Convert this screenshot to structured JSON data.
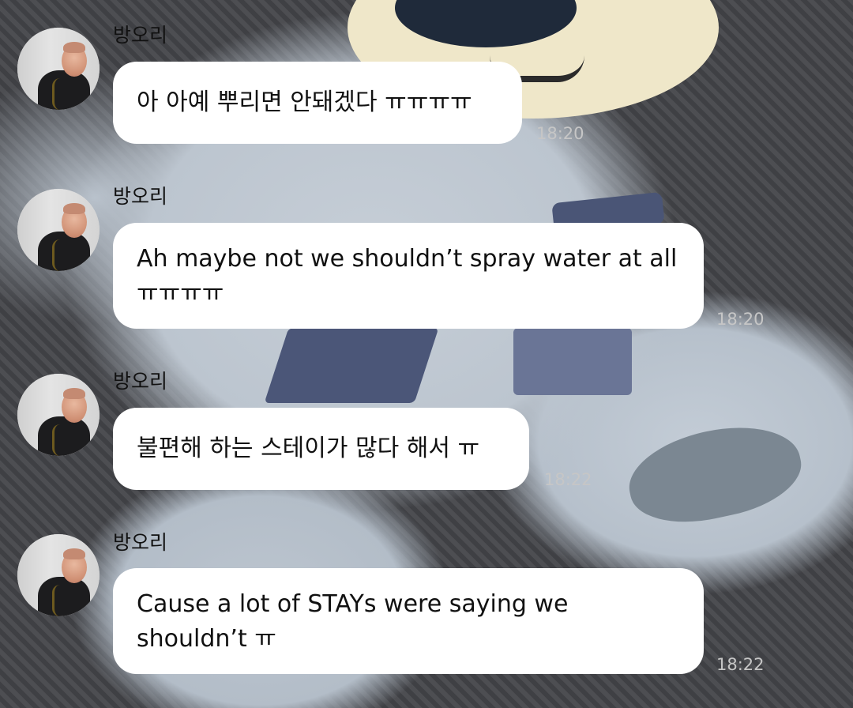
{
  "messages": [
    {
      "sender": "방오리",
      "text": "아 아예 뿌리면 안돼겠다 ㅠㅠㅠㅠ",
      "time": "18:20",
      "avatar_icon": "profile-photo"
    },
    {
      "sender": "방오리",
      "text": "Ah maybe not we shouldn’t spray water at all ㅠㅠㅠㅠ",
      "time": "18:20",
      "avatar_icon": "profile-photo"
    },
    {
      "sender": "방오리",
      "text": "불편해 하는 스테이가 많다 해서 ㅠ",
      "time": "18:22",
      "avatar_icon": "profile-photo"
    },
    {
      "sender": "방오리",
      "text": "Cause a lot of STAYs were saying we shouldn’t ㅠ",
      "time": "18:22",
      "avatar_icon": "profile-photo"
    }
  ],
  "colors": {
    "bubble": "#ffffff",
    "text": "#111111",
    "timestamp": "#c6c6c6"
  }
}
